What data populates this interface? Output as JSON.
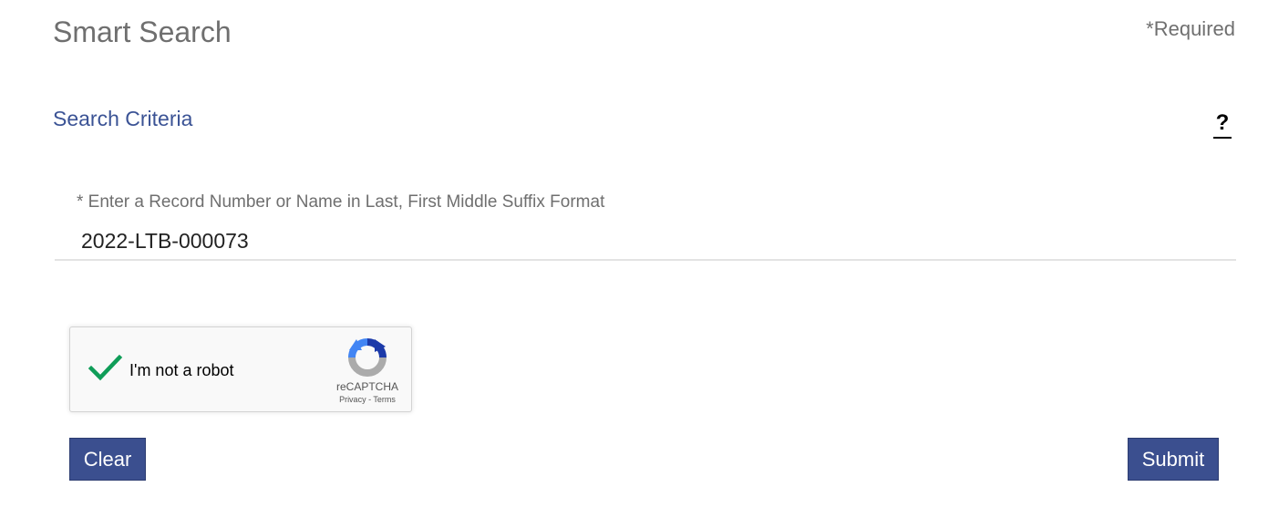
{
  "header": {
    "title": "Smart Search",
    "required_note": "*Required"
  },
  "section": {
    "title": "Search Criteria",
    "help_icon": "?"
  },
  "search": {
    "label": "* Enter a Record Number or Name in Last, First Middle Suffix Format",
    "value": "2022-LTB-000073"
  },
  "captcha": {
    "label": "I'm not a robot",
    "brand": "reCAPTCHA",
    "privacy_link": "Privacy",
    "separator": " - ",
    "terms_link": "Terms",
    "checked": true,
    "check_color": "#0f9d58"
  },
  "actions": {
    "clear_label": "Clear",
    "submit_label": "Submit"
  },
  "colors": {
    "accent": "#3b4f8f",
    "section_title": "#3b5395",
    "muted_text": "#6f6f6f"
  }
}
